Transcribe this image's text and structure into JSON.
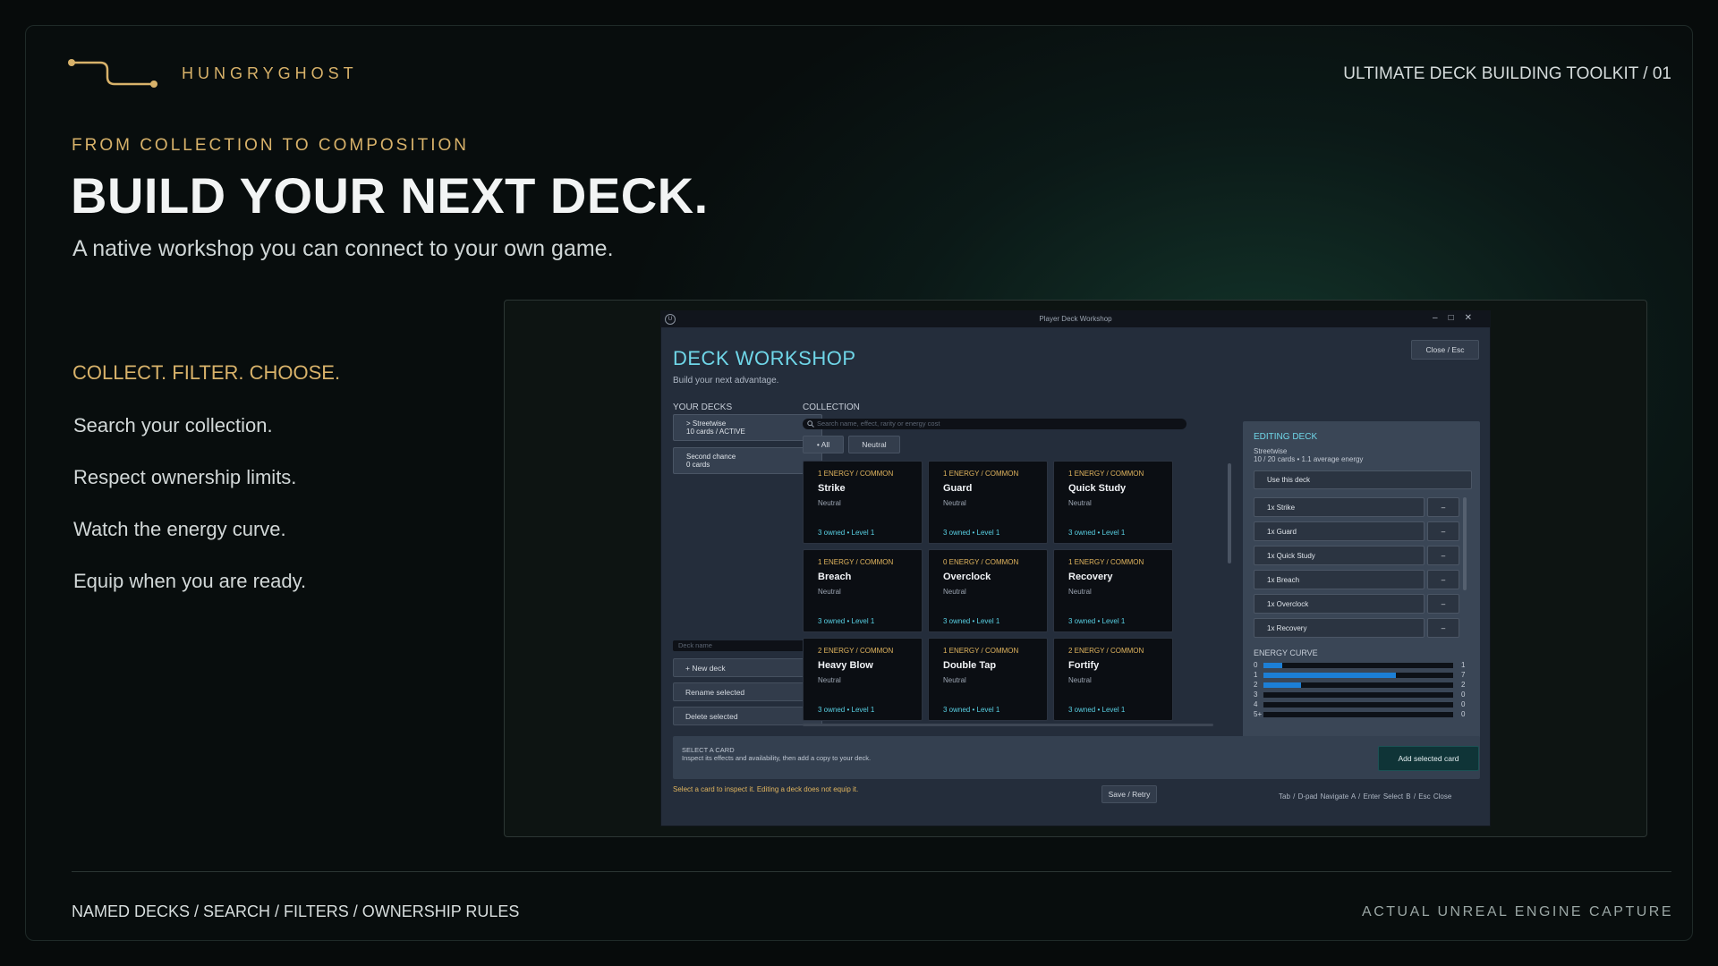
{
  "brand": {
    "name": "HUNGRYGHOST"
  },
  "header": {
    "toolkit": "ULTIMATE DECK BUILDING TOOLKIT / 01"
  },
  "hero": {
    "eyebrow": "FROM COLLECTION TO COMPOSITION",
    "headline": "BUILD YOUR NEXT DECK.",
    "subhead": "A native workshop you can connect to your own game."
  },
  "features": {
    "tagline": "COLLECT. FILTER. CHOOSE.",
    "items": [
      "Search your collection.",
      "Respect ownership limits.",
      "Watch the energy curve.",
      "Equip when you are ready."
    ]
  },
  "footer": {
    "left": "NAMED DECKS / SEARCH / FILTERS / OWNERSHIP RULES",
    "right": "ACTUAL UNREAL ENGINE CAPTURE"
  },
  "window": {
    "title": "Player Deck Workshop",
    "workshop_title": "DECK WORKSHOP",
    "workshop_sub": "Build your next advantage.",
    "close_label": "Close / Esc",
    "your_decks_label": "YOUR DECKS",
    "decks": [
      {
        "line1": "> Streetwise",
        "line2": "10 cards  /  ACTIVE"
      },
      {
        "line1": "Second chance",
        "line2": "0 cards"
      }
    ],
    "deck_name_placeholder": "Deck name",
    "new_deck": "+ New deck",
    "rename": "Rename selected",
    "delete": "Delete selected",
    "collection_label": "COLLECTION",
    "search_placeholder": "Search name, effect, rarity or energy cost",
    "filters": [
      "• All",
      "Neutral"
    ],
    "cards": [
      {
        "cost": "1 ENERGY  /  COMMON",
        "name": "Strike",
        "faction": "Neutral",
        "owned": "3 owned  •  Level 1"
      },
      {
        "cost": "1 ENERGY  /  COMMON",
        "name": "Guard",
        "faction": "Neutral",
        "owned": "3 owned  •  Level 1"
      },
      {
        "cost": "1 ENERGY  /  COMMON",
        "name": "Quick Study",
        "faction": "Neutral",
        "owned": "3 owned  •  Level 1"
      },
      {
        "cost": "1 ENERGY  /  COMMON",
        "name": "Breach",
        "faction": "Neutral",
        "owned": "3 owned  •  Level 1"
      },
      {
        "cost": "0 ENERGY  /  COMMON",
        "name": "Overclock",
        "faction": "Neutral",
        "owned": "3 owned  •  Level 1"
      },
      {
        "cost": "1 ENERGY  /  COMMON",
        "name": "Recovery",
        "faction": "Neutral",
        "owned": "3 owned  •  Level 1"
      },
      {
        "cost": "2 ENERGY  /  COMMON",
        "name": "Heavy Blow",
        "faction": "Neutral",
        "owned": "3 owned  •  Level 1"
      },
      {
        "cost": "1 ENERGY  /  COMMON",
        "name": "Double Tap",
        "faction": "Neutral",
        "owned": "3 owned  •  Level 1"
      },
      {
        "cost": "2 ENERGY  /  COMMON",
        "name": "Fortify",
        "faction": "Neutral",
        "owned": "3 owned  •  Level 1"
      }
    ],
    "editing": {
      "heading": "EDITING DECK",
      "deck_name": "Streetwise",
      "summary": "10 / 20 cards  •  1.1 average energy",
      "use_label": "Use this deck",
      "entries": [
        "1x Strike",
        "1x Guard",
        "1x Quick Study",
        "1x Breach",
        "1x Overclock",
        "1x Recovery"
      ],
      "remove_label": "–",
      "curve_label": "ENERGY CURVE",
      "curve": [
        {
          "cost": "0",
          "count": 1
        },
        {
          "cost": "1",
          "count": 7
        },
        {
          "cost": "2",
          "count": 2
        },
        {
          "cost": "3",
          "count": 0
        },
        {
          "cost": "4",
          "count": 0
        },
        {
          "cost": "5+",
          "count": 0
        }
      ],
      "curve_color": "#1c7fd6"
    },
    "detail": {
      "heading": "SELECT A CARD",
      "desc": "Inspect its effects and availability, then add a copy to your deck.",
      "add_label": "Add selected card"
    },
    "hint": "Select a card to inspect it. Editing a deck does not equip it.",
    "save_label": "Save / Retry",
    "nav_hint": "Tab / D-pad  Navigate    A / Enter  Select    B / Esc  Close"
  },
  "colors": {
    "accent_gold": "#d8b26a",
    "accent_cyan": "#6fd6e8"
  }
}
